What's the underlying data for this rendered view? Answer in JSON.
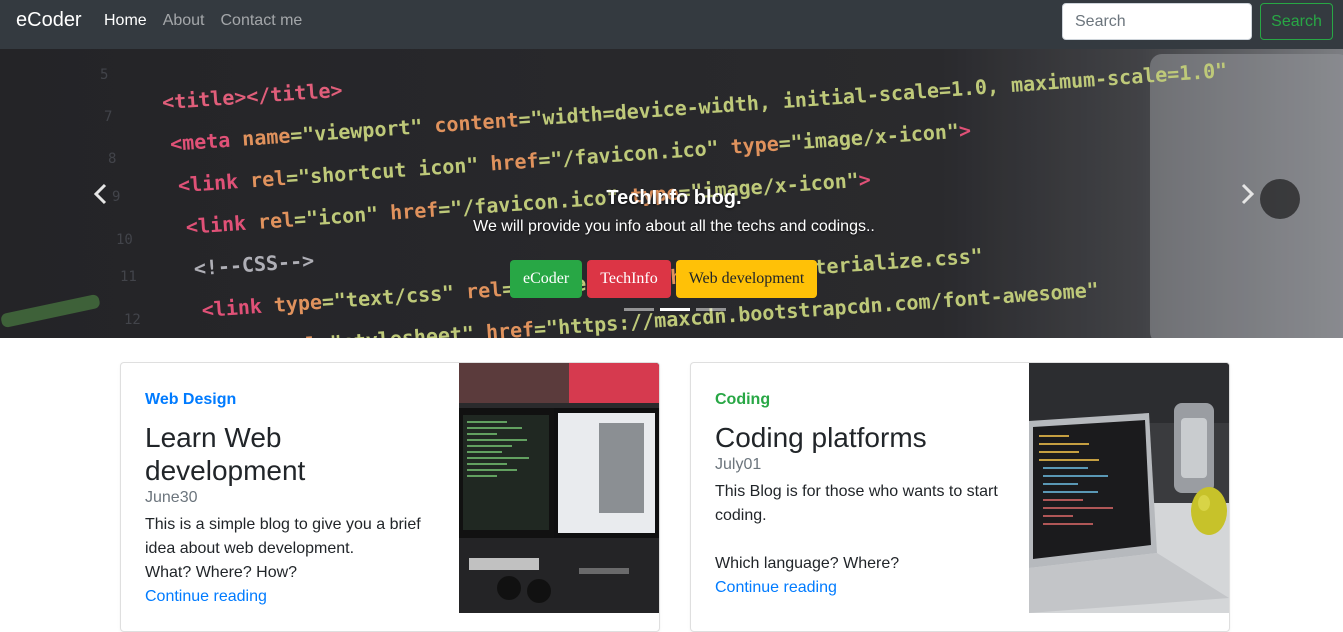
{
  "navbar": {
    "brand": "eCoder",
    "links": [
      {
        "label": "Home",
        "active": true
      },
      {
        "label": "About",
        "active": false
      },
      {
        "label": "Contact me",
        "active": false
      }
    ],
    "search_placeholder": "Search",
    "search_button": "Search"
  },
  "carousel": {
    "title": "TechInfo blog.",
    "subtitle": "We will provide you info about all the techs and codings..",
    "buttons": [
      {
        "label": "eCoder",
        "color": "#28a745"
      },
      {
        "label": "TechInfo",
        "color": "#dc3545"
      },
      {
        "label": "Web development",
        "color": "#ffc107"
      }
    ],
    "active_slide": 2,
    "slide_count": 3
  },
  "cards": [
    {
      "category": "Web Design",
      "category_color": "#007bff",
      "title": "Learn Web development",
      "date": "June30",
      "text": "This is a simple blog to give you a brief idea about web development.\nWhat? Where? How?",
      "link": "Continue reading"
    },
    {
      "category": "Coding",
      "category_color": "#28a745",
      "title": "Coding platforms",
      "date": "July01",
      "text": "This Blog is for those who wants to start coding.\n\nWhich language? Where?",
      "link": "Continue reading"
    }
  ],
  "icons": {
    "prev": "chevron-left-icon",
    "next": "chevron-right-icon"
  }
}
